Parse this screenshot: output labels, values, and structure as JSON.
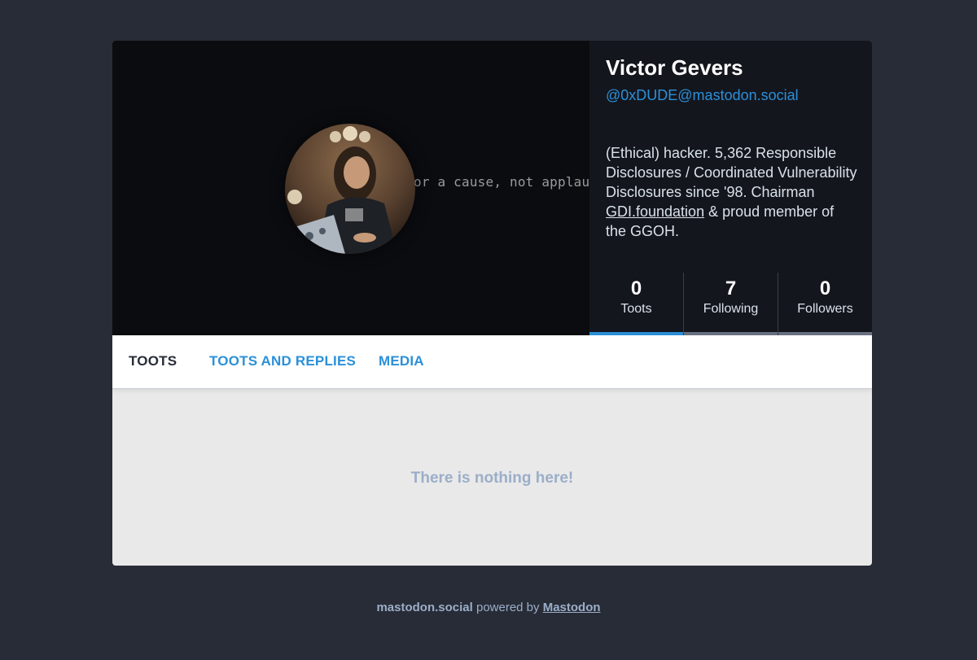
{
  "profile": {
    "display_name": "Victor Gevers",
    "handle": "@0xDUDE@mastodon.social",
    "bio_part1": "(Ethical) hacker. 5,362 Responsible Disclosures / Coordinated Vulnerability Disclosures since '98. Chairman ",
    "bio_link": "GDI.foundation",
    "bio_part2": " & proud member of the GGOH.",
    "cover_text": "or a cause, not applause"
  },
  "counters": [
    {
      "count": "0",
      "label": "Toots"
    },
    {
      "count": "7",
      "label": "Following"
    },
    {
      "count": "0",
      "label": "Followers"
    }
  ],
  "tabs": [
    {
      "label": "TOOTS"
    },
    {
      "label": "TOOTS AND REPLIES"
    },
    {
      "label": "MEDIA"
    }
  ],
  "empty_message": "There is nothing here!",
  "footer": {
    "instance": "mastodon.social",
    "powered_by": " powered by ",
    "software": "Mastodon"
  },
  "colors": {
    "accent": "#2b90d9",
    "background": "#282c37",
    "muted": "#9baec8"
  }
}
